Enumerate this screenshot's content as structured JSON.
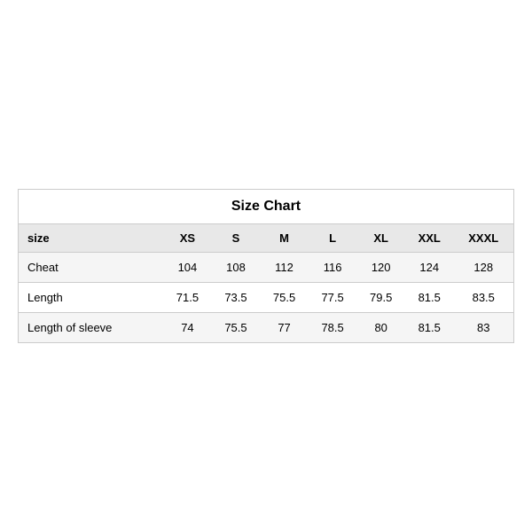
{
  "table": {
    "title": "Size Chart",
    "headers": [
      "size",
      "XS",
      "S",
      "M",
      "L",
      "XL",
      "XXL",
      "XXXL"
    ],
    "rows": [
      {
        "label": "Cheat",
        "values": [
          "104",
          "108",
          "112",
          "116",
          "120",
          "124",
          "128"
        ]
      },
      {
        "label": "Length",
        "values": [
          "71.5",
          "73.5",
          "75.5",
          "77.5",
          "79.5",
          "81.5",
          "83.5"
        ]
      },
      {
        "label": "Length of sleeve",
        "values": [
          "74",
          "75.5",
          "77",
          "78.5",
          "80",
          "81.5",
          "83"
        ]
      }
    ]
  }
}
